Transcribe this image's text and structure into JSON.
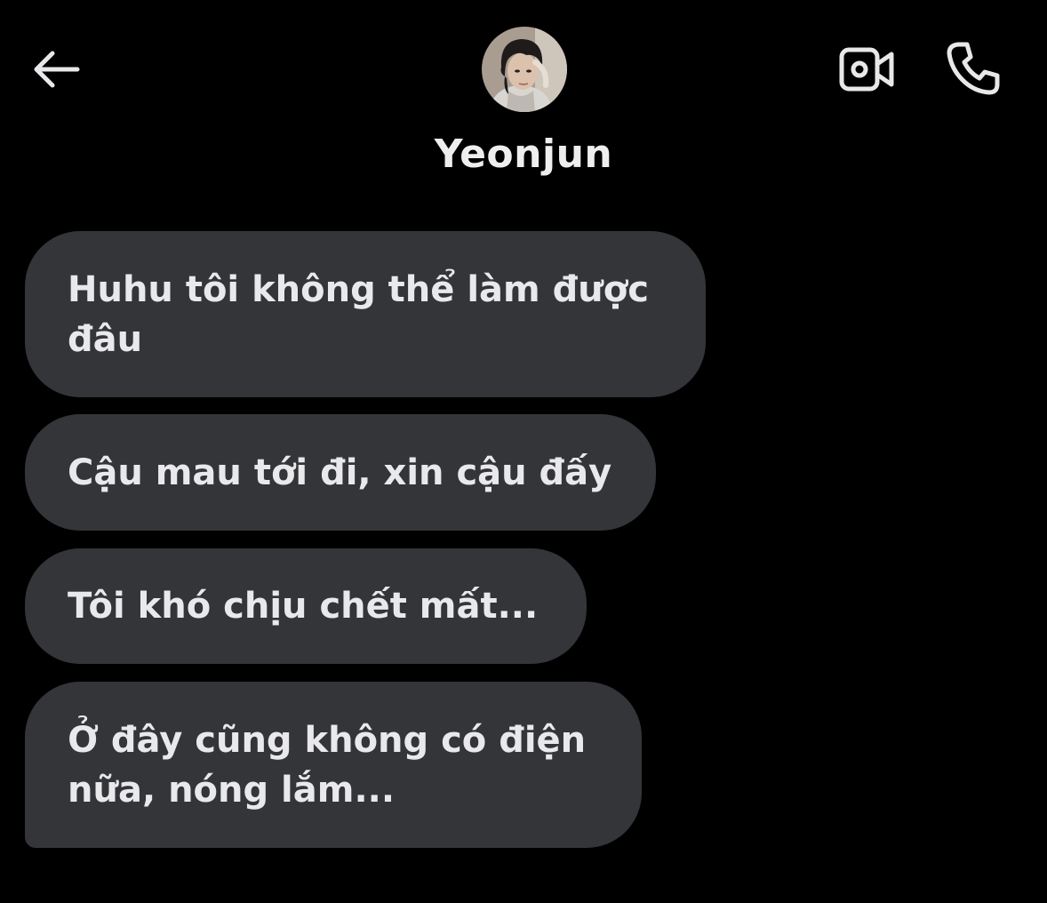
{
  "header": {
    "back_icon": "arrow-left-icon",
    "contact_name": "Yeonjun",
    "video_icon": "video-camera-icon",
    "call_icon": "phone-icon"
  },
  "messages": [
    {
      "text": "Huhu tôi không thể làm được đâu"
    },
    {
      "text": "Cậu mau tới đi, xin cậu đấy"
    },
    {
      "text": "Tôi khó chịu chết mất..."
    },
    {
      "text": "Ở đây cũng không có điện nữa, nóng lắm..."
    }
  ],
  "colors": {
    "background": "#000000",
    "bubble": "#333539",
    "text": "#e9e9eb"
  }
}
